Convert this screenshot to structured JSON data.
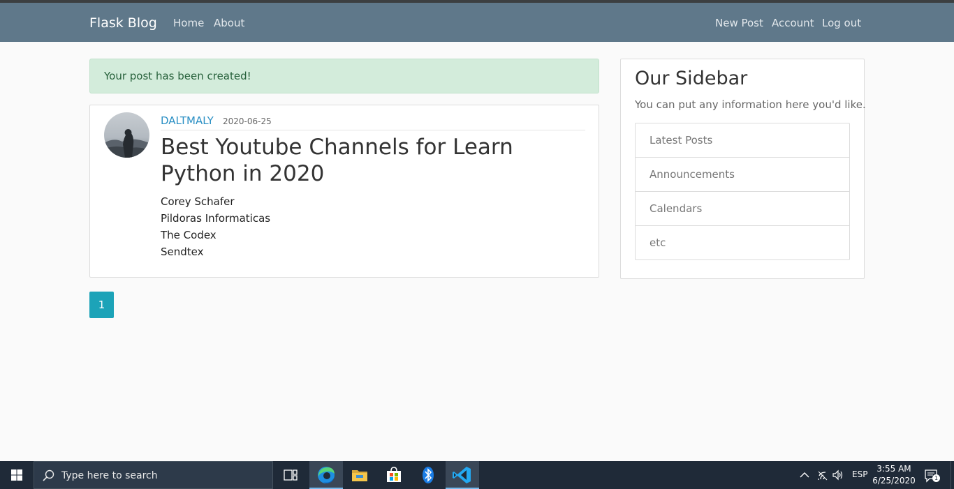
{
  "nav": {
    "brand": "Flask Blog",
    "left_links": [
      "Home",
      "About"
    ],
    "right_links": [
      "New Post",
      "Account",
      "Log out"
    ]
  },
  "alert": {
    "message": "Your post has been created!"
  },
  "post": {
    "author": "DALTMALY",
    "date": "2020-06-25",
    "title": "Best Youtube Channels for Learn Python in 2020",
    "content_lines": [
      "Corey Schafer",
      "Pildoras Informaticas",
      "The Codex",
      "Sendtex"
    ]
  },
  "pagination": {
    "current_page": "1"
  },
  "sidebar": {
    "title": "Our Sidebar",
    "subtitle": "You can put any information here you'd like.",
    "items": [
      "Latest Posts",
      "Announcements",
      "Calendars",
      "etc"
    ]
  },
  "taskbar": {
    "search_placeholder": "Type here to search",
    "apps": [
      "task-view-icon",
      "edge-icon",
      "file-explorer-icon",
      "store-icon",
      "bluetooth-icon",
      "vscode-icon"
    ],
    "language": "ESP",
    "time": "3:55 AM",
    "date": "6/25/2020",
    "notification_count": "1"
  },
  "colors": {
    "navbar": "#5f788a",
    "alert_bg": "#d3ecdb",
    "link": "#2a8fc4",
    "page_button": "#1ca3b8",
    "taskbar": "#1f2a38"
  }
}
